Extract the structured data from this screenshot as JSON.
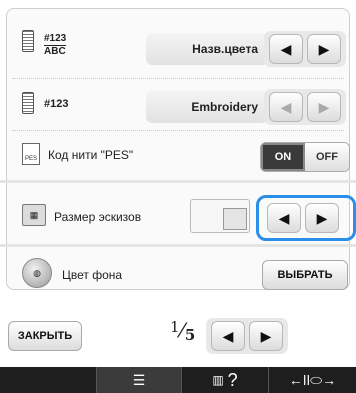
{
  "rows": {
    "thread_display": {
      "stacked_top": "#123",
      "stacked_bottom": "ABC",
      "value": "Назв.цвета",
      "prev": "◀",
      "next": "▶"
    },
    "thread_brand": {
      "label": "#123",
      "value": "Embroidery",
      "prev": "◀",
      "next": "▶"
    },
    "pes_code": {
      "icon_text": "PES",
      "label": "Код нити \"PES\"",
      "on": "ON",
      "off": "OFF",
      "state": "on"
    },
    "thumbnail_size": {
      "label": "Размер эскизов",
      "prev": "◀",
      "next": "▶"
    },
    "background_color": {
      "label": "Цвет фона",
      "button": "ВЫБРАТЬ"
    }
  },
  "footer": {
    "close": "ЗАКРЫТЬ",
    "page_current": "1",
    "page_total": "5",
    "prev": "◀",
    "next": "▶"
  },
  "bottom_bar": {
    "settings_icon": "☰",
    "help": "?",
    "mode": "←ǀǀ⬭→"
  },
  "colors": {
    "highlight": "#2a8fe8",
    "bottom_bar": "#1e1e1e",
    "toggle_on": "#3a3a3a"
  }
}
